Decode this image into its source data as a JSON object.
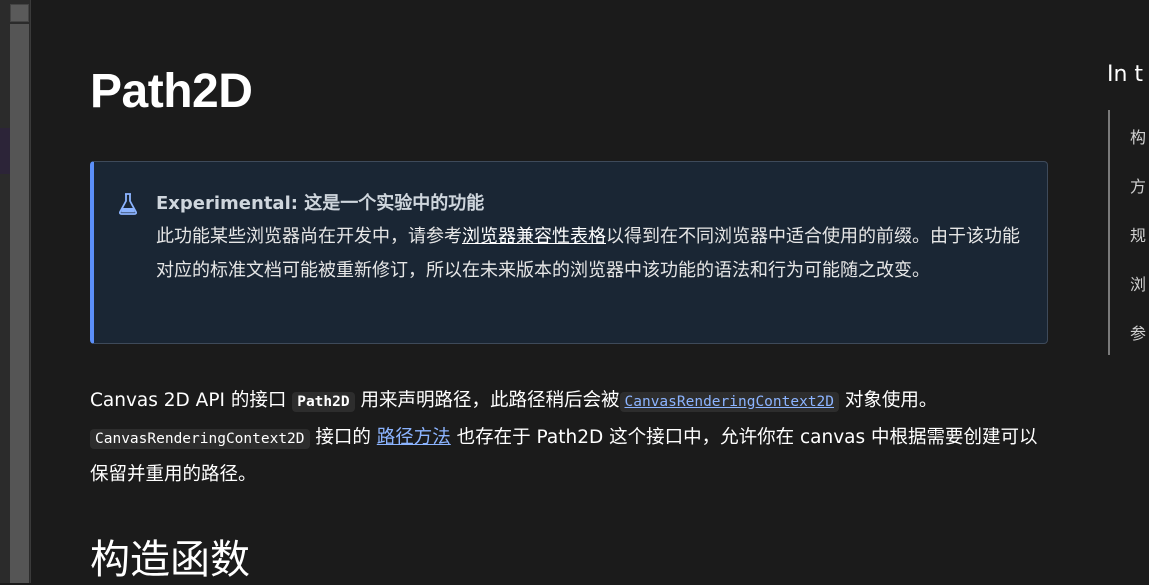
{
  "page": {
    "title": "Path2D",
    "section_heading": "构造函数"
  },
  "notecard": {
    "icon": "flask-icon",
    "heading": "Experimental: 这是一个实验中的功能",
    "body_part1": "此功能某些浏览器尚在开发中，请参考",
    "body_link": "浏览器兼容性表格",
    "body_part2": "以得到在不同浏览器中适合使用的前缀。由于该功能对应的标准文档可能被重新修订，所以在未来版本的浏览器中该功能的语法和行为可能随之改变。"
  },
  "intro": {
    "t1": "Canvas 2D API 的接口 ",
    "code_path2d": "Path2D",
    "t2": " 用来声明路径，此路径稍后会被",
    "link_ctx": "CanvasRenderingContext2D",
    "t3": " 对象使用。",
    "code_ctx": "CanvasRenderingContext2D",
    "t4": " 接口的 ",
    "link_methods": "路径方法",
    "t5": " 也存在于 Path2D 这个接口中，允许你在 canvas 中根据需要创建可以保留并重用的路径。"
  },
  "toc": {
    "title": "In t",
    "items": [
      "构",
      "方",
      "规",
      "浏",
      "参"
    ]
  },
  "colors": {
    "background": "#1b1b1b",
    "notecard_bg": "#1a2634",
    "notecard_accent": "#5b8ff9",
    "link": "#8cb4ff"
  }
}
